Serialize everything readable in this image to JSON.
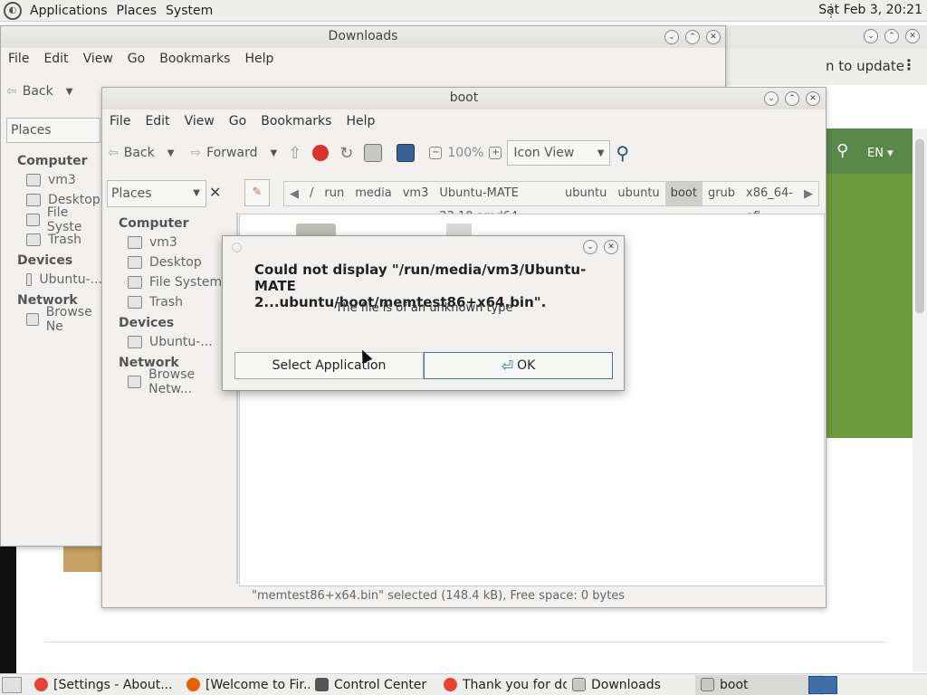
{
  "top_panel": {
    "menus": [
      "Applications",
      "Places",
      "System"
    ],
    "clock": "Sat Feb  3, 20:21"
  },
  "bg_browser": {
    "update_text": "n to update",
    "lang": "EN"
  },
  "downloads_window": {
    "title": "Downloads",
    "menus": [
      "File",
      "Edit",
      "View",
      "Go",
      "Bookmarks",
      "Help"
    ],
    "back_label": "Back",
    "places_label": "Places",
    "sidebar": {
      "computer_header": "Computer",
      "computer_items": [
        "vm3",
        "Desktop",
        "File Syste",
        "Trash"
      ],
      "devices_header": "Devices",
      "devices_items": [
        "Ubuntu-..."
      ],
      "network_header": "Network",
      "network_items": [
        "Browse Ne"
      ]
    }
  },
  "boot_window": {
    "title": "boot",
    "menus": [
      "File",
      "Edit",
      "View",
      "Go",
      "Bookmarks",
      "Help"
    ],
    "toolbar": {
      "back": "Back",
      "forward": "Forward",
      "zoom": "100%",
      "view_mode": "Icon View"
    },
    "places_label": "Places",
    "breadcrumbs": [
      "/",
      "run",
      "media",
      "vm3",
      "Ubuntu-MATE 23.10 amd64",
      "ubuntu",
      "ubuntu",
      "boot",
      "grub",
      "x86_64-efi"
    ],
    "active_crumb": "boot",
    "sidebar": {
      "computer_header": "Computer",
      "computer_items": [
        "vm3",
        "Desktop",
        "File System",
        "Trash"
      ],
      "devices_header": "Devices",
      "devices_items": [
        "Ubuntu-..."
      ],
      "network_header": "Network",
      "network_items": [
        "Browse Netw..."
      ]
    },
    "status": "\"memtest86+x64.bin\" selected (148.4 kB), Free space: 0 bytes"
  },
  "dialog": {
    "message_line1": "Could not display \"/run/media/vm3/Ubuntu-MATE",
    "message_line2": "2...ubuntu/boot/memtest86+x64.bin\".",
    "sub": "The file is of an unknown type",
    "select_app": "Select Application",
    "ok": "OK"
  },
  "taskbar": [
    {
      "label": "[Settings - About...",
      "icon": "chrome-icon"
    },
    {
      "label": "[Welcome to Fir...",
      "icon": "firefox-icon"
    },
    {
      "label": "Control Center",
      "icon": "control-center-icon"
    },
    {
      "label": "Thank you for do...",
      "icon": "chrome-icon"
    },
    {
      "label": "Downloads",
      "icon": "folder-icon"
    },
    {
      "label": "boot",
      "icon": "folder-icon"
    }
  ]
}
